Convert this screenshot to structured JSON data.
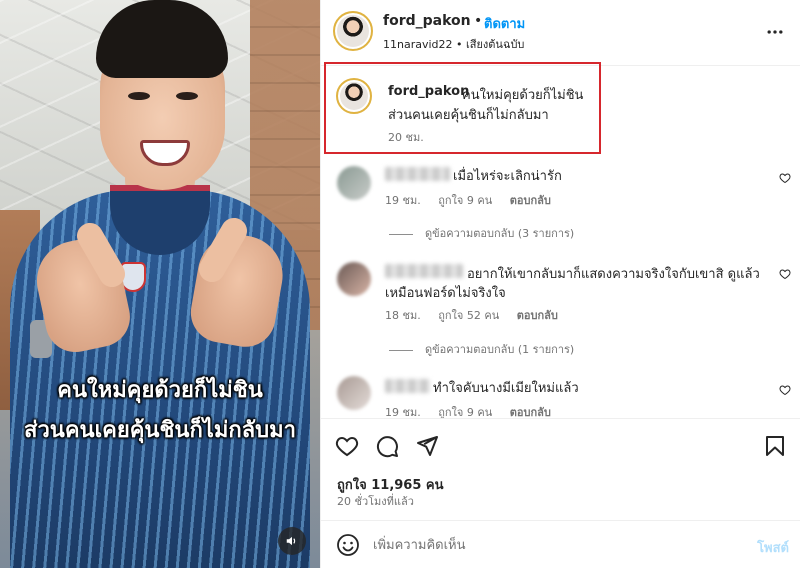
{
  "post": {
    "username": "ford_pakon",
    "follow_label": "ติดตาม",
    "separator": "•",
    "audio_line": "11naravid22 • เสียงต้นฉบับ",
    "video_caption_line1": "คนใหม่คุยด้วยก็ไม่ชิน",
    "video_caption_line2": "ส่วนคนเคยคุ้นชินก็ไม่กลับมา"
  },
  "caption": {
    "username": "ford_pakon",
    "text_line1": "คนใหม่คุยด้วยก็ไม่ชิน",
    "text_line2": "ส่วนคนเคยคุ้นชินก็ไม่กลับมา",
    "time": "20 ชม."
  },
  "comments": [
    {
      "text_line1": "เมื่อไหร่จะเลิกน่ารัก",
      "text_line2": "",
      "time": "19 ชม.",
      "likes": "ถูกใจ 9 คน",
      "reply": "ตอบกลับ",
      "view_replies": "ดูข้อความตอบกลับ (3 รายการ)"
    },
    {
      "text_line1": "อยากให้เขากลับมาก็แสดงความจริงใจกับเขาสิ ดูแล้ว",
      "text_line2": "เหมือนฟอร์ดไม่จริงใจ",
      "time": "18 ชม.",
      "likes": "ถูกใจ 52 คน",
      "reply": "ตอบกลับ",
      "view_replies": "ดูข้อความตอบกลับ (1 รายการ)"
    },
    {
      "text_line1": "ทำใจคับนางมีเมียใหม่แล้ว",
      "text_line2": "",
      "time": "19 ชม.",
      "likes": "ถูกใจ 9 คน",
      "reply": "ตอบกลับ",
      "view_replies": ""
    }
  ],
  "stats": {
    "likes": "ถูกใจ 11,965 คน",
    "ago": "20 ชั่วโมงที่แล้ว"
  },
  "add_comment": {
    "placeholder": "เพิ่มความคิดเห็น",
    "post_label": "โพสต์"
  },
  "icons": {
    "like": "heart-icon",
    "comment": "comment-icon",
    "share": "paper-plane-icon",
    "save": "bookmark-icon",
    "more": "more-horizontal-icon",
    "emoji": "emoji-icon",
    "mute": "speaker-icon"
  },
  "colors": {
    "link": "#0095f6",
    "highlight_box": "#d6272d",
    "post_disabled": "#b2dffc"
  }
}
